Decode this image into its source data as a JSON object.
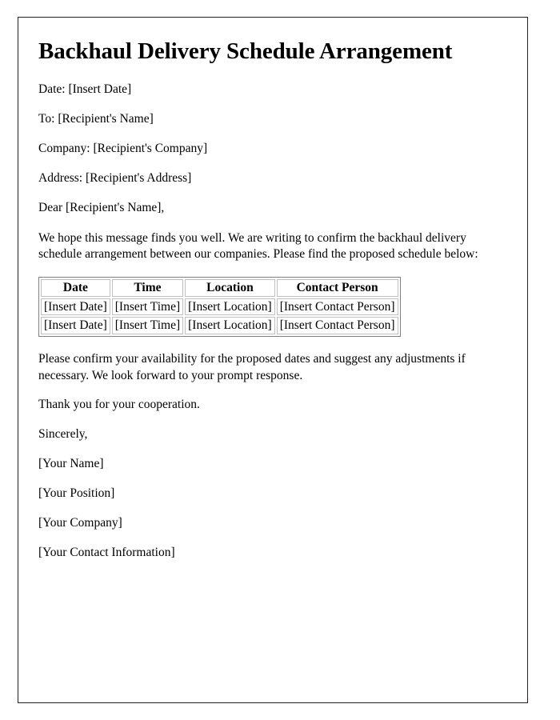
{
  "document": {
    "title": "Backhaul Delivery Schedule Arrangement",
    "header_fields": [
      {
        "label": "Date:",
        "value": "[Insert Date]",
        "text": "Date: [Insert Date]"
      },
      {
        "label": "To:",
        "value": "[Recipient's Name]",
        "text": "To: [Recipient's Name]"
      },
      {
        "label": "Company:",
        "value": "[Recipient's Company]",
        "text": "Company: [Recipient's Company]"
      },
      {
        "label": "Address:",
        "value": "[Recipient's Address]",
        "text": "Address: [Recipient's Address]"
      }
    ],
    "salutation": "Dear [Recipient's Name],",
    "intro_paragraph": "We hope this message finds you well. We are writing to confirm the backhaul delivery schedule arrangement between our companies. Please find the proposed schedule below:",
    "schedule_table": {
      "columns": [
        "Date",
        "Time",
        "Location",
        "Contact Person"
      ],
      "rows": [
        [
          "[Insert Date]",
          "[Insert Time]",
          "[Insert Location]",
          "[Insert Contact Person]"
        ],
        [
          "[Insert Date]",
          "[Insert Time]",
          "[Insert Location]",
          "[Insert Contact Person]"
        ]
      ]
    },
    "closing_paragraph": "Please confirm your availability for the proposed dates and suggest any adjustments if necessary. We look forward to your prompt response.",
    "thanks_line": "Thank you for your cooperation.",
    "sign_off": "Sincerely,",
    "signature_block": [
      "[Your Name]",
      "[Your Position]",
      "[Your Company]",
      "[Your Contact Information]"
    ]
  },
  "colors": {
    "page_border": "#231f20",
    "text": "#000000",
    "background": "#ffffff",
    "table_outer_border": "#808080",
    "table_cell_border": "#c0c0c0"
  }
}
